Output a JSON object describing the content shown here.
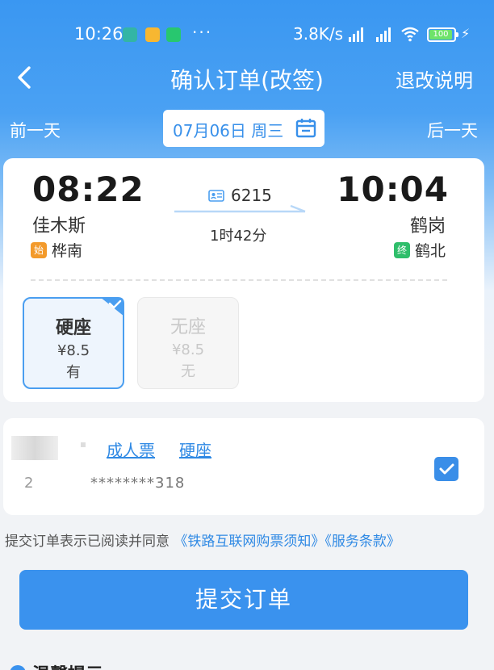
{
  "status_bar": {
    "time": "10:26",
    "dots": "···",
    "speed": "3.8K/s",
    "battery": "100",
    "app_icon_colors": [
      "#33b5a5",
      "#f7b731",
      "#28c76f"
    ]
  },
  "nav": {
    "title": "确认订单(改签)",
    "rules_link": "退改说明"
  },
  "date_bar": {
    "prev_day": "前一天",
    "date": "07月06日 周三",
    "next_day": "后一天"
  },
  "train": {
    "departure_time": "08:22",
    "departure_city": "佳木斯",
    "departure_station": "桦南",
    "start_tag": "始",
    "arrival_time": "10:04",
    "arrival_city": "鹤岗",
    "arrival_station": "鹤北",
    "end_tag": "终",
    "train_number": "6215",
    "duration": "1时42分"
  },
  "seats": [
    {
      "name": "硬座",
      "price": "¥8.5",
      "availability": "有",
      "selected": true
    },
    {
      "name": "无座",
      "price": "¥8.5",
      "availability": "无",
      "selected": false
    }
  ],
  "passenger": {
    "ticket_type": "成人票",
    "seat_type": "硬座",
    "id_prefix": "2",
    "id_number": "********318",
    "checked": true
  },
  "agreement": {
    "prefix": "提交订单表示已阅读并同意",
    "link1": "《铁路互联网购票须知》",
    "link2": "《服务条款》"
  },
  "submit_label": "提交订单",
  "tips_title": "温馨提示",
  "colors": {
    "primary": "#3a92ee",
    "link": "#2f89e4",
    "start_tag": "#f39a2b",
    "end_tag": "#2fbe6b"
  }
}
